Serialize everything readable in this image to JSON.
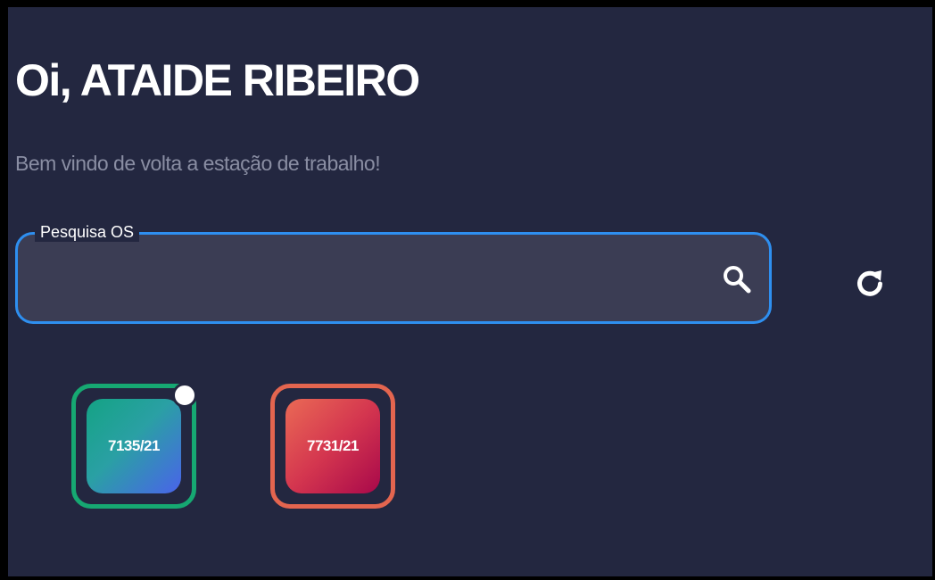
{
  "header": {
    "greeting": "Oi, ATAIDE RIBEIRO",
    "subtitle": "Bem vindo de volta a estação de trabalho!"
  },
  "search": {
    "label": "Pesquisa OS",
    "value": "",
    "icon": "search-icon",
    "refresh_icon": "refresh-icon"
  },
  "orders": [
    {
      "id": "7135/21",
      "status_color": "#16a872",
      "selected": true
    },
    {
      "id": "7731/21",
      "status_color": "#e3654f",
      "selected": false
    }
  ],
  "colors": {
    "background": "#232740",
    "accent": "#2e8ff0",
    "green": "#16a872",
    "red": "#e3654f"
  }
}
